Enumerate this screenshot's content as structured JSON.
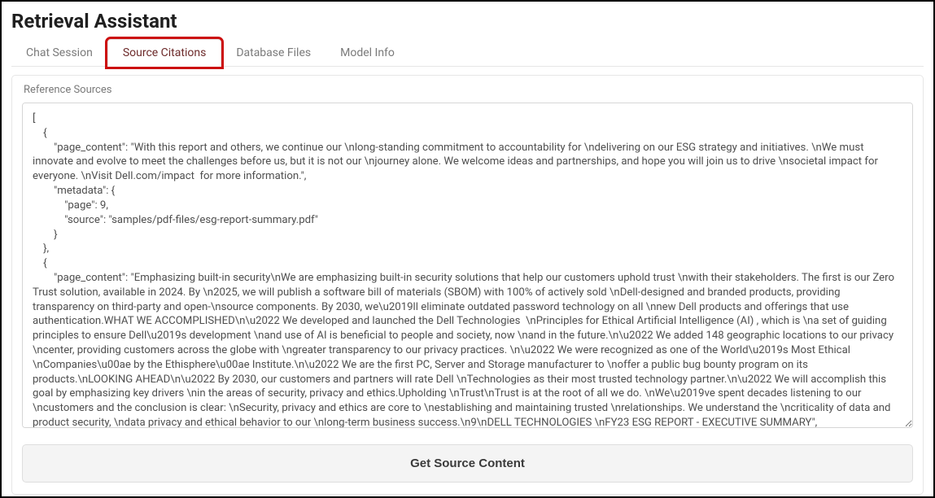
{
  "header": {
    "title": "Retrieval Assistant"
  },
  "tabs": {
    "chat": "Chat Session",
    "sources": "Source Citations",
    "db": "Database Files",
    "model": "Model Info"
  },
  "panel": {
    "label": "Reference Sources",
    "button_label": "Get Source Content",
    "content": "[\n    {\n        \"page_content\": \"With this report and others, we continue our \\nlong-standing commitment to accountability for \\ndelivering on our ESG strategy and initiatives. \\nWe must innovate and evolve to meet the challenges before us, but it is not our \\njourney alone. We welcome ideas and partnerships, and hope you will join us to drive \\nsocietal impact for everyone. \\nVisit Dell.com/impact  for more information.\",\n        \"metadata\": {\n            \"page\": 9,\n            \"source\": \"samples/pdf-files/esg-report-summary.pdf\"\n        }\n    },\n    {\n        \"page_content\": \"Emphasizing built-in security\\nWe are emphasizing built-in security solutions that help our customers uphold trust \\nwith their stakeholders. The first is our Zero Trust solution, available in 2024. By \\n2025, we will publish a software bill of materials (SBOM) with 100% of actively sold \\nDell-designed and branded products, providing transparency on third-party and open-\\nsource components. By 2030, we\\u2019ll eliminate outdated password technology on all \\nnew Dell products and offerings that use authentication.WHAT WE ACCOMPLISHED\\n\\u2022 We developed and launched the Dell Technologies  \\nPrinciples for Ethical Artificial Intelligence (AI) , which is \\na set of guiding principles to ensure Dell\\u2019s development \\nand use of AI is beneficial to people and society, now \\nand in the future.\\n\\u2022 We added 148 geographic locations to our privacy \\ncenter, providing customers across the globe with \\ngreater transparency to our privacy practices. \\n\\u2022 We were recognized as one of the World\\u2019s Most Ethical \\nCompanies\\u00ae by the Ethisphere\\u00ae Institute.\\n\\u2022 We are the first PC, Server and Storage manufacturer to \\noffer a public bug bounty program on its products.\\nLOOKING AHEAD\\n\\u2022 By 2030, our customers and partners will rate Dell \\nTechnologies as their most trusted technology partner.\\n\\u2022 We will accomplish this goal by emphasizing key drivers \\nin the areas of security, privacy and ethics.Upholding \\nTrust\\nTrust is at the root of all we do. \\nWe\\u2019ve spent decades listening to our \\ncustomers and the conclusion is clear: \\nSecurity, privacy and ethics are core to \\nestablishing and maintaining trusted \\nrelationships. We understand the \\ncriticality of data and product security, \\ndata privacy and ethical behavior to our \\nlong-term business success.\\n9\\nDELL TECHNOLOGIES \\nFY23 ESG REPORT - EXECUTIVE SUMMARY\",\n        \"metadata\": {"
  }
}
